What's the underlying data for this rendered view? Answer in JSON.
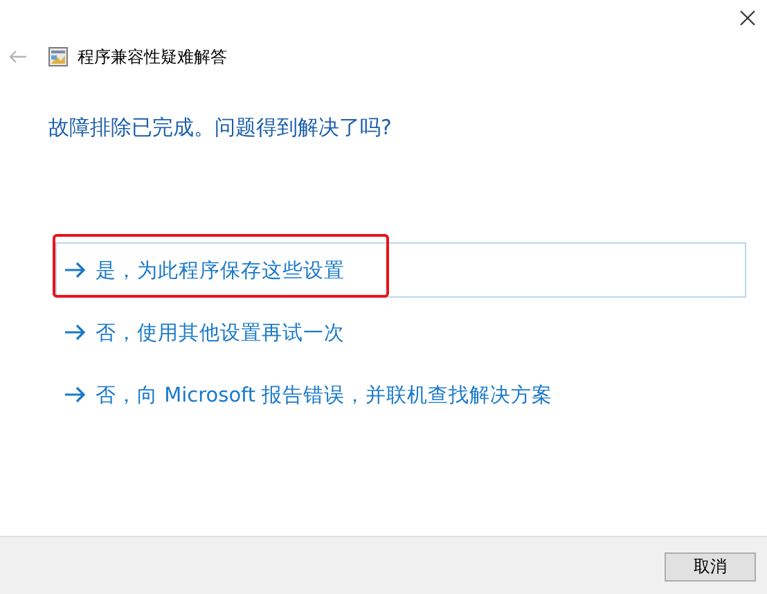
{
  "window": {
    "title": "程序兼容性疑难解答"
  },
  "heading": "故障排除已完成。问题得到解决了吗?",
  "options": [
    {
      "label": "是，为此程序保存这些设置",
      "selected": true,
      "highlighted": true
    },
    {
      "label": "否，使用其他设置再试一次",
      "selected": false,
      "highlighted": false
    },
    {
      "label": "否，向 Microsoft 报告错误，并联机查找解决方案",
      "selected": false,
      "highlighted": false
    }
  ],
  "buttons": [
    {
      "label": "取消"
    }
  ]
}
